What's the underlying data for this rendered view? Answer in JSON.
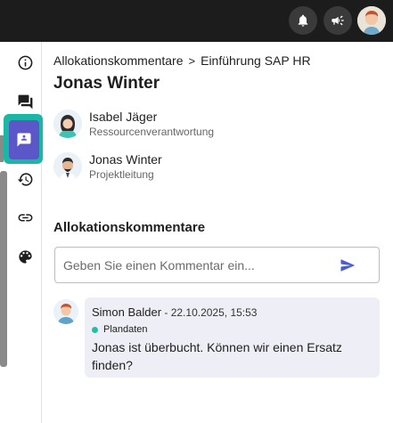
{
  "header": {
    "icons": [
      "bell-icon",
      "megaphone-icon"
    ],
    "avatar": "user-avatar"
  },
  "rail": {
    "items": [
      "info-icon",
      "chat-icon",
      "comment-icon",
      "history-icon",
      "link-icon",
      "palette-icon"
    ],
    "active_index": 2,
    "colors": {
      "active_bg": "#5b57c9",
      "active_outline": "#19b7a4"
    }
  },
  "breadcrumb": {
    "parent": "Allokationskommentare",
    "separator": ">",
    "current": "Einführung SAP HR"
  },
  "page_title": "Jonas Winter",
  "people": [
    {
      "name": "Isabel Jäger",
      "role": "Ressourcenverantwortung"
    },
    {
      "name": "Jonas Winter",
      "role": "Projektleitung"
    }
  ],
  "comments_section": {
    "title": "Allokationskommentare",
    "placeholder": "Geben Sie einen Kommentar ein...",
    "send_icon": "send-icon"
  },
  "comments": [
    {
      "author": "Simon Balder",
      "date": " - 22.10.2025, 15:53",
      "tag": "Plandaten",
      "tag_color": "#1fbfa7",
      "text": "Jonas ist überbucht. Können wir einen Ersatz finden?"
    }
  ]
}
